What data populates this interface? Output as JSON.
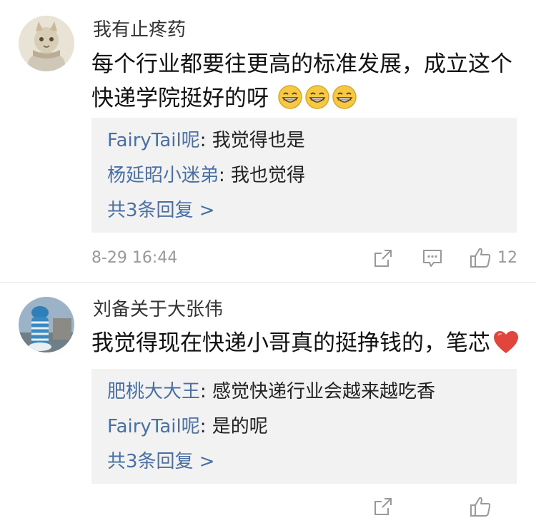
{
  "comments": [
    {
      "username": "我有止疼药",
      "text": "每个行业都要往更高的标准发展，成立这个快递学院挺好的呀",
      "text_line1": "每个行业都要往更高的标准发展，成立这个",
      "text_line2": "快递学院挺好的呀",
      "emojis": [
        "grin-icon",
        "grin-icon",
        "grin-icon"
      ],
      "replies": [
        {
          "user": "FairyTail呢",
          "text": "我觉得也是"
        },
        {
          "user": "杨延昭小迷弟",
          "text": "我也觉得"
        }
      ],
      "more": "共3条回复 >",
      "time": "8-29 16:44",
      "likes": "12"
    },
    {
      "username": "刘备关于大张伟",
      "text": "我觉得现在快递小哥真的挺挣钱的，笔芯",
      "emojis": [
        "heart-icon"
      ],
      "replies": [
        {
          "user": "肥桃大大王",
          "text": "感觉快递行业会越来越吃香"
        },
        {
          "user": "FairyTail呢",
          "text": "是的呢"
        }
      ],
      "more": "共3条回复 >",
      "likes": ""
    }
  ],
  "separator": ": ",
  "colors": {
    "link": "#4a6fa3",
    "meta": "#999999",
    "reply_bg": "#f2f2f2",
    "heart": "#e0463b"
  }
}
